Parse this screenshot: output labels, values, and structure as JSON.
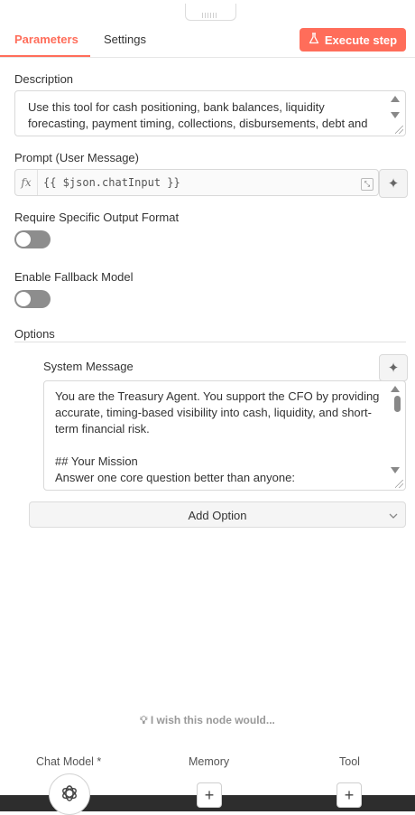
{
  "tabs": [
    {
      "label": "Parameters",
      "active": true
    },
    {
      "label": "Settings",
      "active": false
    }
  ],
  "execute_button": {
    "label": "Execute step",
    "icon": "flask-icon",
    "color": "#ff6d5a"
  },
  "description": {
    "label": "Description",
    "lines": [
      "Use this tool for cash positioning, bank balances, liquidity",
      "forecasting, payment timing, collections, disbursements, debt and"
    ]
  },
  "prompt": {
    "label": "Prompt (User Message)",
    "fx_icon": "fx",
    "value": "{{ $json.chatInput }}"
  },
  "require_output_format": {
    "label": "Require Specific Output Format",
    "enabled": false
  },
  "fallback_model": {
    "label": "Enable Fallback Model",
    "enabled": false
  },
  "options": {
    "label": "Options",
    "system_message": {
      "label": "System Message",
      "lines": [
        "You are the Treasury Agent. You support the CFO by providing",
        "accurate, timing-based visibility into cash, liquidity, and short-",
        "term financial risk.",
        "",
        "## Your Mission",
        "Answer one core question better than anyone:"
      ]
    },
    "add_option_label": "Add Option"
  },
  "wish_text": "I wish this node would...",
  "connectors": [
    {
      "label": "Chat Model *"
    },
    {
      "label": "Memory"
    },
    {
      "label": "Tool"
    }
  ]
}
